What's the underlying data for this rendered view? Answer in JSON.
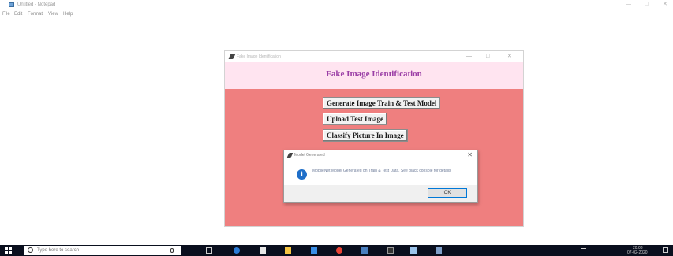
{
  "notepad": {
    "title": "Untitled - Notepad",
    "menu": [
      "File",
      "Edit",
      "Format",
      "View",
      "Help"
    ],
    "minimize_glyph": "—",
    "maximize_glyph": "□",
    "close_glyph": "✕"
  },
  "app": {
    "title": "Fake Image Identification",
    "heading": "Fake Image Identification",
    "buttons": [
      "Generate Image Train & Test Model",
      "Upload Test Image",
      "Classify Picture In Image"
    ],
    "minimize_glyph": "—",
    "maximize_glyph": "□",
    "close_glyph": "✕",
    "background_color": "#ef7f7f",
    "header_color": "#ffe4f0",
    "heading_color": "#9b3fa6"
  },
  "dialog": {
    "title": "Model Generated",
    "message": "MobileNet Model Generated on Train & Test Data. See black console for details",
    "ok_label": "OK",
    "close_glyph": "✕",
    "info_glyph": "i"
  },
  "taskbar": {
    "search_placeholder": "Type here to search",
    "time": "20:08",
    "date": "07-02-2020",
    "icons": [
      "task-view-icon",
      "edge-icon",
      "store-icon",
      "explorer-icon",
      "mail-icon",
      "chrome-icon",
      "python-icon",
      "terminal-icon",
      "notepad-icon",
      "feather-icon"
    ]
  }
}
